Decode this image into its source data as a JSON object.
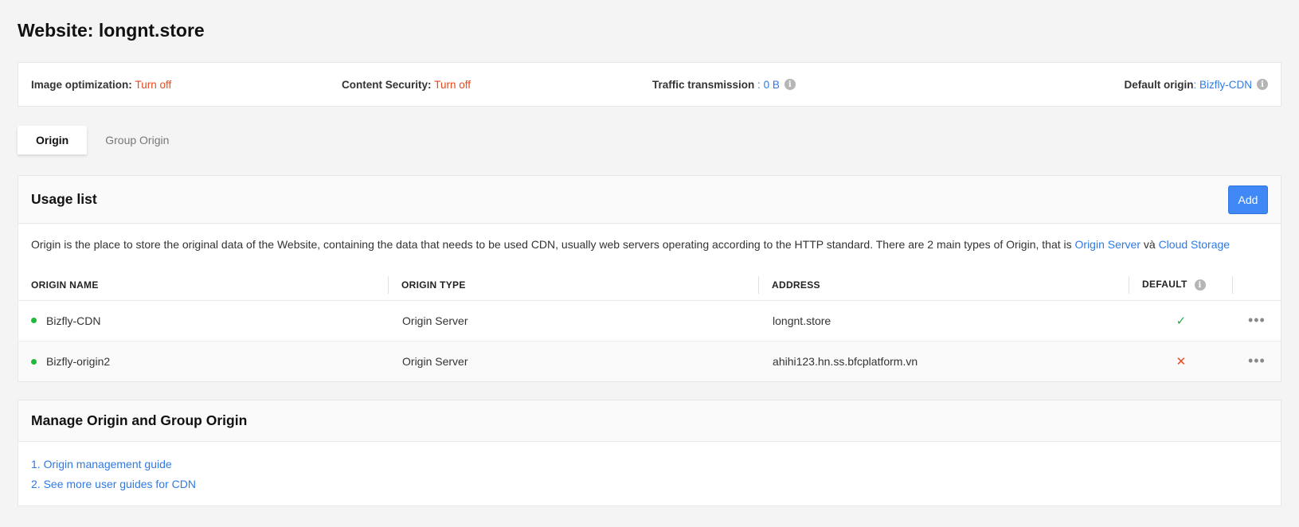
{
  "page": {
    "title": "Website: longnt.store"
  },
  "summary": {
    "image_optimization": {
      "label": "Image optimization:",
      "value": "Turn off"
    },
    "content_security": {
      "label": "Content Security:",
      "value": "Turn off"
    },
    "traffic": {
      "label": "Traffic transmission",
      "sep": " : ",
      "value": "0 B"
    },
    "default_origin": {
      "label": "Default origin",
      "sep": ": ",
      "value": "Bizfly-CDN"
    }
  },
  "tabs": [
    {
      "label": "Origin",
      "active": true
    },
    {
      "label": "Group Origin",
      "active": false
    }
  ],
  "usage": {
    "title": "Usage list",
    "add_label": "Add",
    "description": "Origin is the place to store the original data of the Website, containing the data that needs to be used CDN, usually web servers operating according to the HTTP standard. There are 2 main types of Origin, that is ",
    "link_origin_server": "Origin Server",
    "conj": " và ",
    "link_cloud_storage": "Cloud Storage",
    "columns": {
      "name": "ORIGIN NAME",
      "type": "ORIGIN TYPE",
      "address": "ADDRESS",
      "default": "DEFAULT"
    },
    "rows": [
      {
        "name": "Bizfly-CDN",
        "type": "Origin Server",
        "address": "longnt.store",
        "default": "✓",
        "status_color": "#1fb83a"
      },
      {
        "name": "Bizfly-origin2",
        "type": "Origin Server",
        "address": "ahihi123.hn.ss.bfcplatform.vn",
        "default": "✕",
        "status_color": "#1fb83a"
      }
    ],
    "more_label": "•••"
  },
  "manage": {
    "title": "Manage Origin and Group Origin",
    "links": [
      "1. Origin management guide",
      "2. See more user guides for CDN"
    ]
  },
  "icons": {
    "info": "info-icon",
    "check": "check-icon",
    "cross": "cross-icon",
    "more": "more-icon"
  },
  "colors": {
    "accent": "#3f88f5",
    "link": "#2f7ae5",
    "warning": "#e8491d",
    "success": "#1fb83a"
  }
}
